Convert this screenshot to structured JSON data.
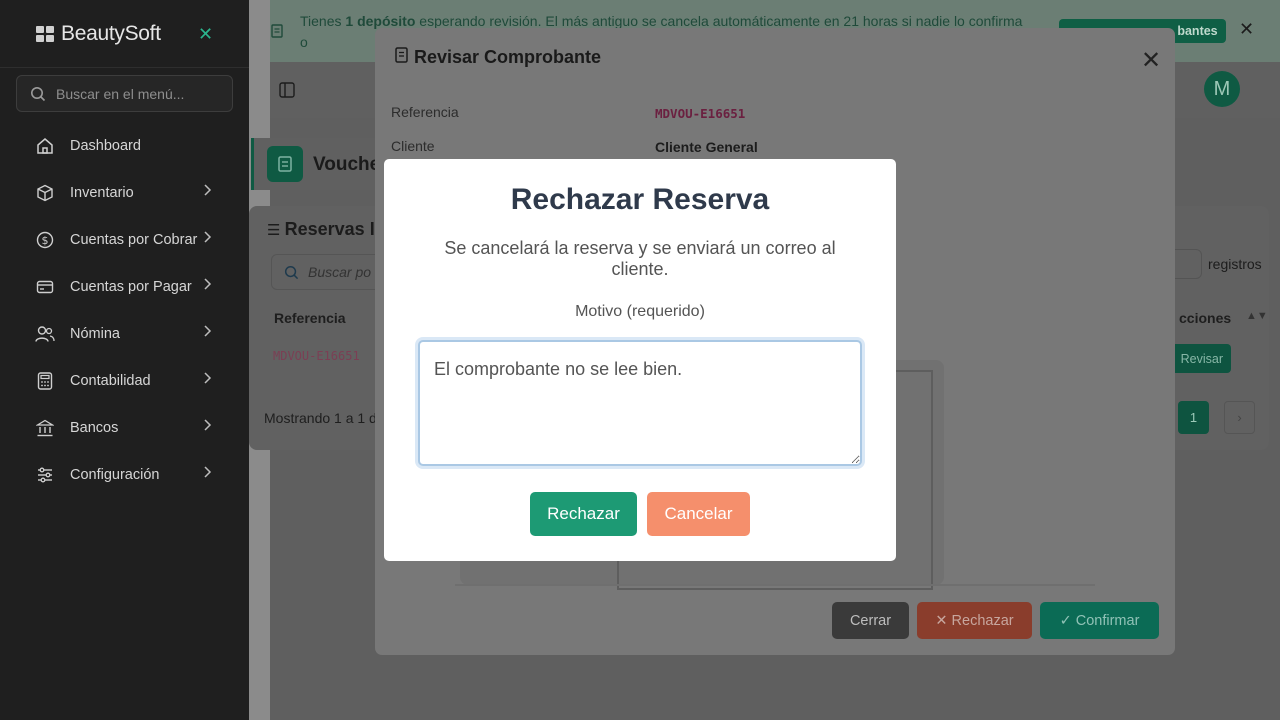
{
  "sidebar": {
    "brand": "BeautySoft",
    "search_placeholder": "Buscar en el menú...",
    "items": [
      {
        "label": "Dashboard",
        "icon": "home-icon",
        "has_children": false
      },
      {
        "label": "Inventario",
        "icon": "box-icon",
        "has_children": true
      },
      {
        "label": "Cuentas por Cobrar",
        "icon": "dollar-icon",
        "has_children": true
      },
      {
        "label": "Cuentas por Pagar",
        "icon": "card-icon",
        "has_children": true
      },
      {
        "label": "Nómina",
        "icon": "users-icon",
        "has_children": true
      },
      {
        "label": "Contabilidad",
        "icon": "calculator-icon",
        "has_children": true
      },
      {
        "label": "Bancos",
        "icon": "bank-icon",
        "has_children": true
      },
      {
        "label": "Configuración",
        "icon": "sliders-icon",
        "has_children": true
      }
    ]
  },
  "banner": {
    "text_before": "Tienes ",
    "text_bold": "1 depósito",
    "text_after": " esperando revisión. El más antiguo se cancela automáticamente en 21 horas si nadie lo confirma o",
    "button_label": "bantes"
  },
  "header": {
    "avatar_initial": "M"
  },
  "page": {
    "title": "Vouche"
  },
  "list": {
    "title": "Reservas I",
    "search_placeholder": "Buscar po",
    "col_reference": "Referencia",
    "col_actions": "cciones",
    "row_reference": "MDVOU-E16651",
    "row_action": "Revisar",
    "showing": "Mostrando 1 a 1 d",
    "records_label": "registros",
    "page_number": "1"
  },
  "review_modal": {
    "title": "Revisar Comprobante",
    "fields": [
      {
        "label": "Referencia",
        "value": "MDVOU-E16651"
      },
      {
        "label": "Cliente",
        "value": "Cliente General"
      }
    ],
    "buttons": {
      "close": "Cerrar",
      "reject": "✕ Rechazar",
      "confirm": "✓ Confirmar"
    }
  },
  "reject_dialog": {
    "title": "Rechazar Reserva",
    "message": "Se cancelará la reserva y se enviará un correo al cliente.",
    "reason_label": "Motivo (requerido)",
    "reason_value": "El comprobante no se lee bien.",
    "confirm_label": "Rechazar",
    "cancel_label": "Cancelar"
  },
  "colors": {
    "sidebar_bg": "#1f1f1f",
    "brand_accent": "#2bb58e",
    "primary_green": "#1d9a74",
    "cancel_orange": "#f58f6c",
    "title_text": "#2f3a4b"
  }
}
